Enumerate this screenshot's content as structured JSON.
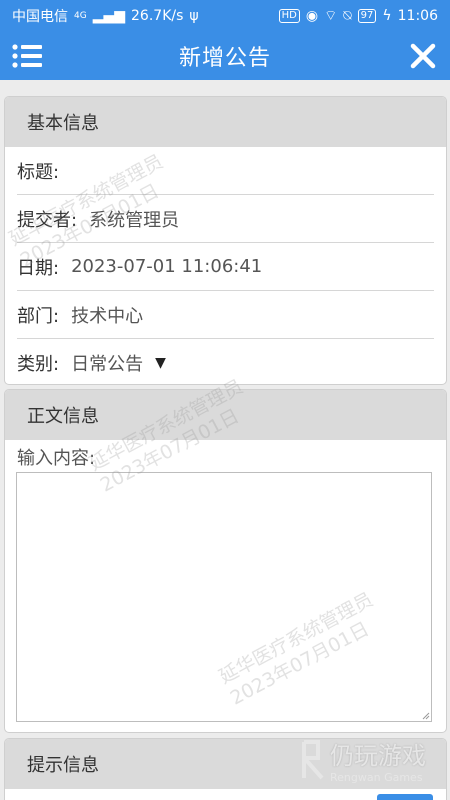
{
  "status_bar": {
    "carrier": "中国电信",
    "signal": "4G",
    "speed": "26.7K/s",
    "hd": "HD",
    "battery": "97",
    "time": "11:06"
  },
  "header": {
    "title": "新增公告",
    "menu_icon": "hamburger-icon",
    "close_icon": "close-icon"
  },
  "basic_info": {
    "title": "基本信息",
    "fields": [
      {
        "label": "标题:",
        "value": ""
      },
      {
        "label": "提交者:",
        "value": "系统管理员"
      },
      {
        "label": "日期:",
        "value": "2023-07-01 11:06:41"
      },
      {
        "label": "部门:",
        "value": "技术中心"
      },
      {
        "label": "类别:",
        "value": "日常公告"
      }
    ]
  },
  "body_info": {
    "title": "正文信息",
    "content_label": "输入内容:"
  },
  "tip_info": {
    "title": "提示信息"
  },
  "watermark": {
    "line1": "延华医疗系统管理员",
    "line2": "2023年07月01日"
  },
  "logo": {
    "name": "仍玩游戏",
    "sub": "Rengwan Games"
  },
  "colors": {
    "primary": "#3a8ee6",
    "section_header": "#dadada"
  }
}
